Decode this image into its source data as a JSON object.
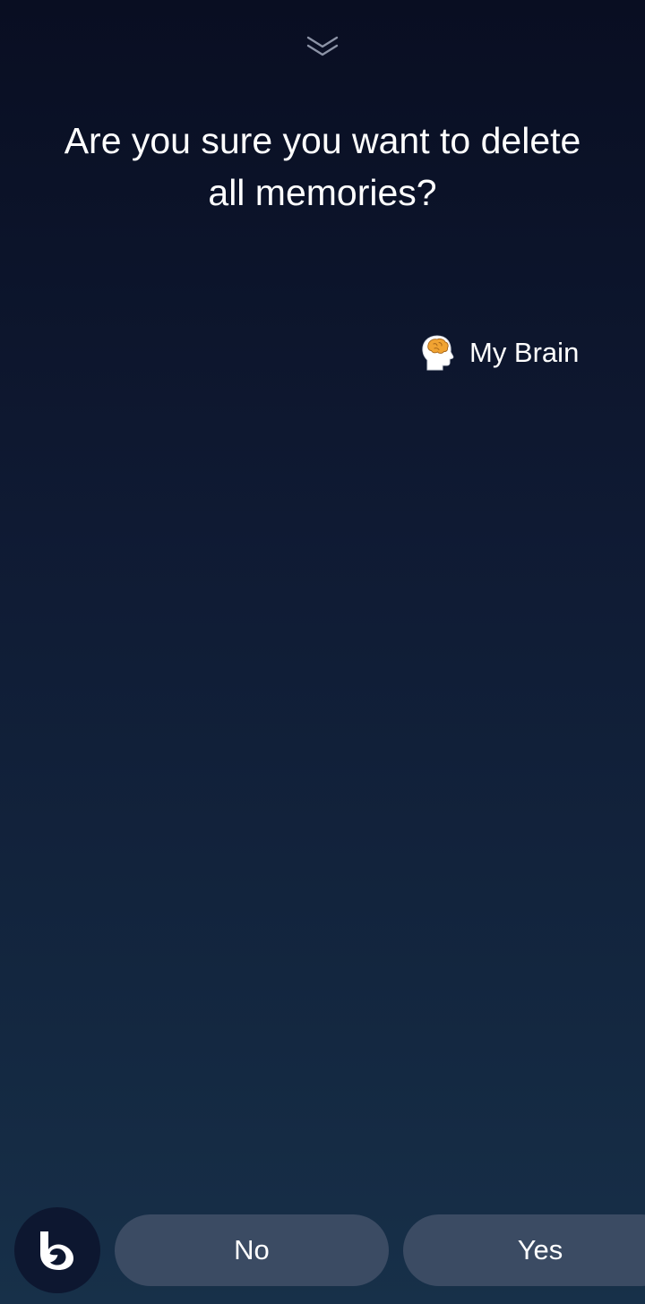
{
  "header": {
    "collapse_icon": "chevron-double-down-icon"
  },
  "dialog": {
    "question": "Are you sure you want to delete all memories?"
  },
  "capsule": {
    "icon": "brain-head-icon",
    "label": "My Brain"
  },
  "footer": {
    "assistant_icon": "bixby-icon",
    "buttons": [
      {
        "label": "No"
      },
      {
        "label": "Yes"
      }
    ]
  },
  "colors": {
    "background_top": "#090e22",
    "background_bottom": "#173049",
    "button_fill": "#3b4b63",
    "assistant_fill": "#0d1730",
    "brain_accent": "#f0a332"
  }
}
